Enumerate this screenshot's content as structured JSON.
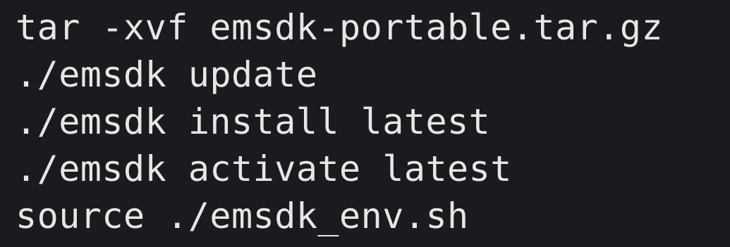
{
  "terminal": {
    "lines": [
      "tar -xvf emsdk-portable.tar.gz",
      "./emsdk update",
      "./emsdk install latest",
      "./emsdk activate latest",
      "source ./emsdk_env.sh"
    ]
  },
  "colors": {
    "background": "#1a1b1f",
    "text": "#e6e6e6"
  }
}
